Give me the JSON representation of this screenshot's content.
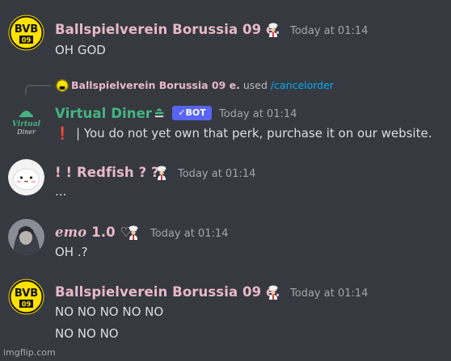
{
  "messages": [
    {
      "author": "Ballspielverein Borussia 09 e.",
      "timestamp": "Today at 01:14",
      "lines": [
        "OH GOD"
      ]
    },
    {
      "reply": {
        "user": "Ballspielverein Borussia 09 e.",
        "used_text": "used",
        "command": "/cancelorder"
      },
      "author": "Virtual Diner",
      "bot_tag": "BOT",
      "timestamp": "Today at 01:14",
      "lines": [
        "| You do not yet own that perk, purchase it on our website."
      ],
      "alert_glyph": "❗"
    },
    {
      "author": "! ! Redfish ? ?",
      "timestamp": "Today at 01:14",
      "lines": [
        "..."
      ]
    },
    {
      "author_script": "emo",
      "author": "1.0 ♡",
      "timestamp": "Today at 01:14",
      "lines": [
        "OH .?"
      ]
    },
    {
      "author": "Ballspielverein Borussia 09 e.",
      "timestamp": "Today at 01:14",
      "lines": [
        "NO NO NO NO NO",
        "NO NO NO"
      ]
    }
  ],
  "avatar_labels": {
    "bvb_top": "BVB",
    "bvb_bottom": "09",
    "diner_line1": "Virtual",
    "diner_line2": "Diner"
  },
  "watermark": "imgflip.com",
  "colors": {
    "background": "#36393f",
    "name_pink": "#e8b8c8",
    "bot_green": "#43b581",
    "bot_badge": "#5865f2",
    "link_blue": "#00aff4",
    "bvb_yellow": "#fde100"
  },
  "icons": [
    "chef-icon",
    "bvb-logo",
    "virtual-diner-logo",
    "verified-check-icon"
  ]
}
